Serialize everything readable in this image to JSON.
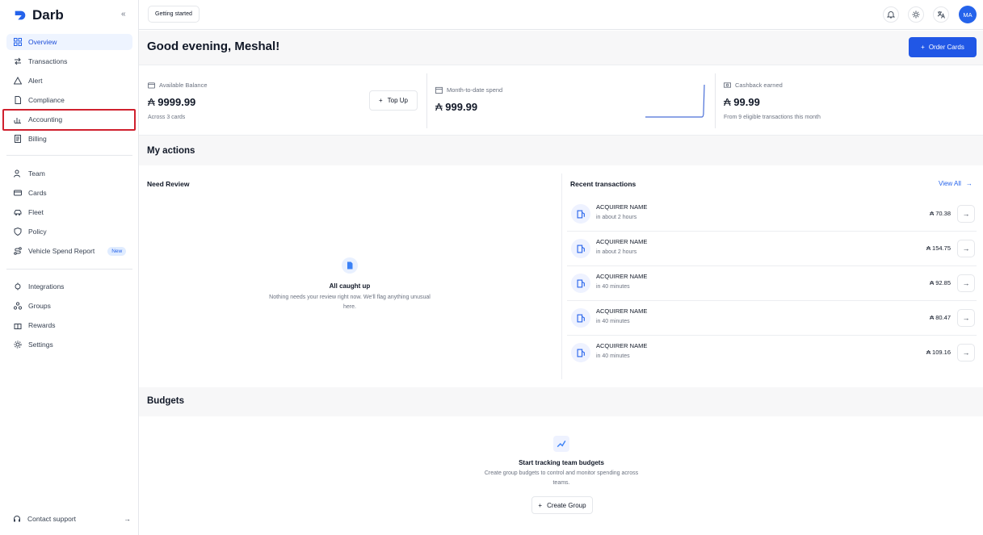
{
  "app": {
    "name": "Darb",
    "collapse_icon": "«"
  },
  "sidebar": {
    "items": [
      {
        "label": "Overview",
        "icon": "grid-icon",
        "active": true
      },
      {
        "label": "Transactions",
        "icon": "arrows-icon"
      },
      {
        "label": "Alert",
        "icon": "alert-triangle-icon"
      },
      {
        "label": "Compliance",
        "icon": "document-icon"
      },
      {
        "label": "Accounting",
        "icon": "chart-icon"
      },
      {
        "label": "Billing",
        "icon": "receipt-icon"
      },
      {
        "label": "Team",
        "icon": "users-icon"
      },
      {
        "label": "Cards",
        "icon": "card-icon"
      },
      {
        "label": "Fleet",
        "icon": "car-icon"
      },
      {
        "label": "Policy",
        "icon": "shield-icon"
      },
      {
        "label": "Vehicle Spend Report",
        "icon": "route-icon",
        "badge": "New"
      },
      {
        "label": "Integrations",
        "icon": "plug-icon"
      },
      {
        "label": "Groups",
        "icon": "groups-icon"
      },
      {
        "label": "Rewards",
        "icon": "gift-icon"
      },
      {
        "label": "Settings",
        "icon": "gear-icon"
      }
    ],
    "support_label": "Contact support",
    "support_arrow": "→"
  },
  "topbar": {
    "getting_started": "Getting started",
    "avatar_initials": "MA"
  },
  "greeting": "Good evening, Meshal!",
  "order_cards": {
    "icon": "+",
    "label": "Order Cards"
  },
  "stats": {
    "currency_symbol": "₳",
    "balance": {
      "label": "Available Balance",
      "value": "9999.99",
      "sub": "Across 3 cards"
    },
    "topup": {
      "icon": "+",
      "label": "Top Up"
    },
    "month": {
      "label": "Month-to-date spend",
      "value": "999.99"
    },
    "cashback": {
      "label": "Cashback earned",
      "value": "99.99",
      "sub": "From 9 eligible transactions this month"
    }
  },
  "actions": {
    "title": "My actions",
    "need_review": {
      "title": "Need Review",
      "empty_title": "All caught up",
      "empty_desc_line1": "Nothing needs your review right now. We'll flag anything unusual",
      "empty_desc_line2": "here."
    },
    "recent": {
      "title": "Recent transactions",
      "view_all": "View All",
      "view_all_arrow": "→",
      "rows": [
        {
          "name": "ACQUIRER NAME",
          "time": "in about 2 hours",
          "amount": "70.38"
        },
        {
          "name": "ACQUIRER NAME",
          "time": "in about 2 hours",
          "amount": "154.75"
        },
        {
          "name": "ACQUIRER NAME",
          "time": "in 40 minutes",
          "amount": "92.85"
        },
        {
          "name": "ACQUIRER NAME",
          "time": "in 40 minutes",
          "amount": "80.47"
        },
        {
          "name": "ACQUIRER NAME",
          "time": "in 40 minutes",
          "amount": "109.16"
        }
      ]
    }
  },
  "budgets": {
    "title": "Budgets",
    "empty_title": "Start tracking team budgets",
    "empty_desc_line1": "Create group budgets to control and monitor spending across",
    "empty_desc_line2": "teams.",
    "create_icon": "+",
    "create_label": "Create Group"
  },
  "colors": {
    "accent": "#2157e6",
    "highlight": "#d0202e"
  }
}
